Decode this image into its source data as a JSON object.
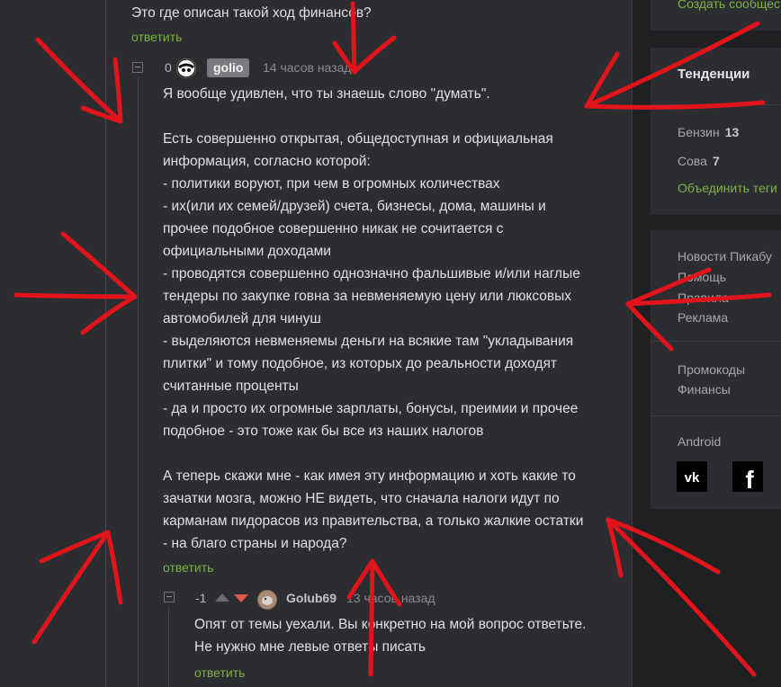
{
  "colors": {
    "accent_green": "#7cb342",
    "vote_down": "#e25a43",
    "annotation_red": "#e0141a"
  },
  "comment_parent": {
    "text": "Это где описан такой ход финансов?",
    "reply_label": "ответить"
  },
  "comment_main": {
    "rating": "0",
    "author": "golio",
    "time": "14 часов назад",
    "lines": [
      "Я вообще удивлен, что ты знаешь слово \"думать\".",
      "",
      "Есть совершенно открытая, общедоступная и официальная",
      "информация, согласно которой:",
      "- политики воруют, при чем в огромных количествах",
      "- их(или их семей/друзей) счета, бизнесы, дома, машины и",
      "прочее подобное совершенно никак не сочитается с",
      "официальными доходами",
      "- проводятся совершенно однозначно фальшивые и/или наглые",
      "тендеры по закупке говна за невменяемую цену или люксовых",
      "автомобилей для чинуш",
      "- выделяются невменяемы деньги на всякие там \"укладывания",
      "плитки\" и тому подобное, из которых до реальности доходят",
      "считанные проценты",
      "- да и просто их огромные зарплаты, бонусы, преимии и прочее",
      "подобное - это тоже как бы все из наших налогов",
      "",
      "А теперь скажи мне - как имея эту информацию и хоть какие то",
      "зачатки мозга, можно НЕ видеть, что сначала налоги идут по",
      "карманам пидорасов из правительства, а только жалкие остатки",
      "- на благо страны и народа?"
    ],
    "reply_label": "ответить"
  },
  "comment_reply": {
    "rating": "-1",
    "author": "Golub69",
    "time": "13 часов назад",
    "lines": [
      "Опят от темы уехали. Вы конкретно на мой вопрос ответьте.",
      "Не нужно мне левые ответы писать"
    ],
    "reply_label": "ответить"
  },
  "sidebar": {
    "create_message": "Создать сообщество",
    "trends_title": "Тенденции",
    "trends": [
      {
        "name": "Бензин",
        "count": "13"
      },
      {
        "name": "Сова",
        "count": "7"
      }
    ],
    "merge_tags": "Объединить теги",
    "links": [
      "Новости Пикабу",
      "Помощь",
      "Правила",
      "Реклама"
    ],
    "links2": [
      "Промокоды",
      "Финансы"
    ],
    "android": "Android",
    "socials": [
      {
        "name": "vk",
        "icon": "vk-icon"
      },
      {
        "name": "facebook",
        "icon": "facebook-icon"
      }
    ]
  }
}
